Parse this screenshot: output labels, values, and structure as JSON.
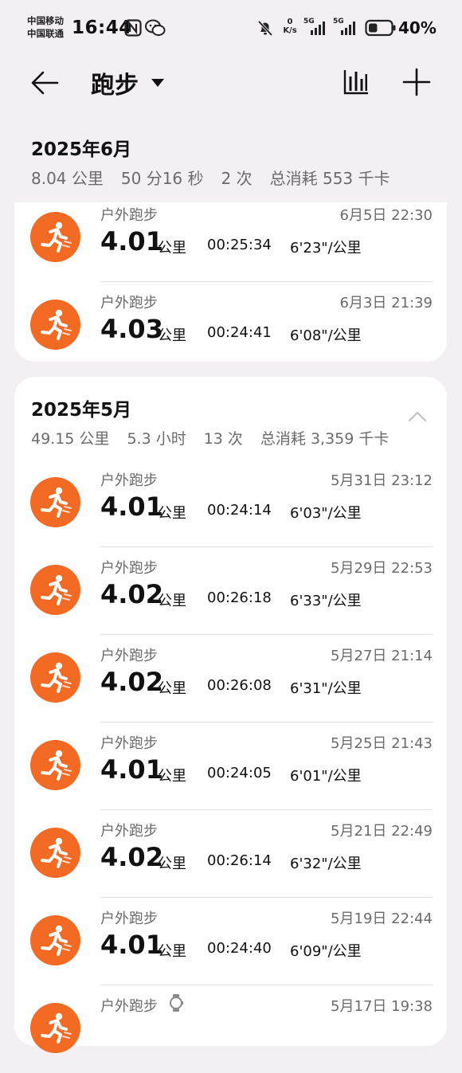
{
  "status": {
    "carrier1": "中国移动",
    "carrier2": "中国联通",
    "time": "16:44",
    "speed_top": "0",
    "speed_unit": "K/s",
    "net1": "5G",
    "net2": "5G",
    "battery": "40%",
    "battery_level": 0.4
  },
  "header": {
    "title": "跑步"
  },
  "months": [
    {
      "title": "2025年6月",
      "stats": [
        "8.04 公里",
        "50 分16 秒",
        "2 次",
        "总消耗 553 千卡"
      ],
      "runs": [
        {
          "type": "户外跑步",
          "date": "6月5日 22:30",
          "distance": "4.01",
          "unit": "公里",
          "duration": "00:25:34",
          "pace": "6'23\"/公里"
        },
        {
          "type": "户外跑步",
          "date": "6月3日 21:39",
          "distance": "4.03",
          "unit": "公里",
          "duration": "00:24:41",
          "pace": "6'08\"/公里"
        }
      ]
    },
    {
      "title": "2025年5月",
      "stats": [
        "49.15 公里",
        "5.3 小时",
        "13 次",
        "总消耗 3,359 千卡"
      ],
      "runs": [
        {
          "type": "户外跑步",
          "date": "5月31日 23:12",
          "distance": "4.01",
          "unit": "公里",
          "duration": "00:24:14",
          "pace": "6'03\"/公里"
        },
        {
          "type": "户外跑步",
          "date": "5月29日 22:53",
          "distance": "4.02",
          "unit": "公里",
          "duration": "00:26:18",
          "pace": "6'33\"/公里"
        },
        {
          "type": "户外跑步",
          "date": "5月27日 21:14",
          "distance": "4.02",
          "unit": "公里",
          "duration": "00:26:08",
          "pace": "6'31\"/公里"
        },
        {
          "type": "户外跑步",
          "date": "5月25日 21:43",
          "distance": "4.01",
          "unit": "公里",
          "duration": "00:24:05",
          "pace": "6'01\"/公里"
        },
        {
          "type": "户外跑步",
          "date": "5月21日 22:49",
          "distance": "4.02",
          "unit": "公里",
          "duration": "00:26:14",
          "pace": "6'32\"/公里"
        },
        {
          "type": "户外跑步",
          "date": "5月19日 22:44",
          "distance": "4.01",
          "unit": "公里",
          "duration": "00:24:40",
          "pace": "6'09\"/公里"
        },
        {
          "type": "户外跑步",
          "date": "5月17日 19:38",
          "distance": "",
          "unit": "",
          "duration": "",
          "pace": "",
          "watch": "watch-icon"
        }
      ]
    }
  ],
  "colors": {
    "accent": "#f26a23",
    "background": "#f4eff3",
    "card": "#ffffff",
    "muted": "#6b6b6b"
  }
}
